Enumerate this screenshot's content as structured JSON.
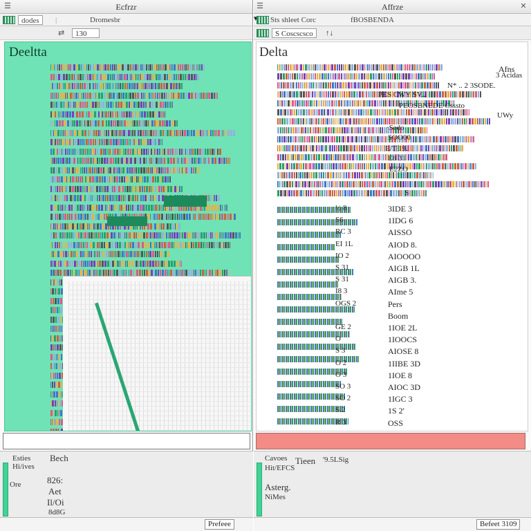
{
  "left_window": {
    "title": "Ecfrzr",
    "toolbar": {
      "item1": "dodes",
      "item2": "Dromesbr"
    },
    "subbar": {
      "field_value": "130"
    },
    "document_title": "Deeltta",
    "status": {
      "label_top": "Esties",
      "value_top": "Bech",
      "label_mid": "Hi/ives",
      "value_mid": "826:",
      "label_low": "Ore",
      "value_low1": "Aet",
      "value_low2": "Il/Oi",
      "value_low3": "8d8G"
    },
    "footer_button": "Prefeee"
  },
  "right_window": {
    "title": "Affrze",
    "toolbar": {
      "item1": "Sts shleet Corc",
      "item2": "fBOSBENDA"
    },
    "subbar": {
      "field_value": "S Coscscsco",
      "item2": "↑↓"
    },
    "document_title": "Delta",
    "header_right": "Afns",
    "top_rows": [
      {
        "label": "3 Acidas",
        "value": ""
      },
      {
        "label": "N*  ..  2  3SODE.",
        "value": ""
      },
      {
        "label": "PES  CWY SV...",
        "value": ""
      },
      {
        "label": "PEOSBNEDE Csssto",
        "value": ""
      },
      {
        "label": "UWy",
        "value": ""
      },
      {
        "label": "·Sedo",
        "value": ""
      },
      {
        "label": "SOO00",
        "value": ""
      },
      {
        "label": "E/T 19.",
        "value": ""
      },
      {
        "label": "E8 31",
        "value": ""
      },
      {
        "label": "E2ZO",
        "value": ""
      },
      {
        "label": "S",
        "value": ""
      }
    ],
    "rows": [
      {
        "code": "½ 8",
        "value": "3IDE 3"
      },
      {
        "code": "S6",
        "value": "1IDG 6"
      },
      {
        "code": "RC 3",
        "value": "AISSO"
      },
      {
        "code": "EI 1L",
        "value": "AIOD 8."
      },
      {
        "code": "IO 2",
        "value": "AIOOOO"
      },
      {
        "code": "S 31",
        "value": "AIGB 1L"
      },
      {
        "code": "S 31",
        "value": "AIGB 3."
      },
      {
        "code": "I8 3",
        "value": "AIme 5"
      },
      {
        "code": "OGS 2",
        "value": "Pers"
      },
      {
        "code": "",
        "value": "Boom"
      },
      {
        "code": "GE 2",
        "value": "1IOE 2L"
      },
      {
        "code": "O",
        "value": "1IOOCS"
      },
      {
        "code": "S 3",
        "value": "AIOSE 8"
      },
      {
        "code": "O 2",
        "value": "1IIBE 3D"
      },
      {
        "code": "O 3",
        "value": "1IOE 8"
      },
      {
        "code": "SO 3",
        "value": "AIOC 3D"
      },
      {
        "code": "SO 2",
        "value": "1IGC 3"
      },
      {
        "code": "S.2",
        "value": "1S 2'"
      },
      {
        "code": "R 3",
        "value": "OSS"
      }
    ],
    "status": {
      "label_top": "Cavoes",
      "value_top": "Tieen",
      "value_top2": "'9.5LSig",
      "label_mid": "Hit/EFCS",
      "value_mid": "Asterg.",
      "label_low": "NiMes"
    },
    "footer_button": "Befeet 3109"
  },
  "colors": {
    "left_doc_bg": "#6fe2b6",
    "accent_green": "#1d8a5c",
    "right_input_bg": "#f38b86"
  }
}
